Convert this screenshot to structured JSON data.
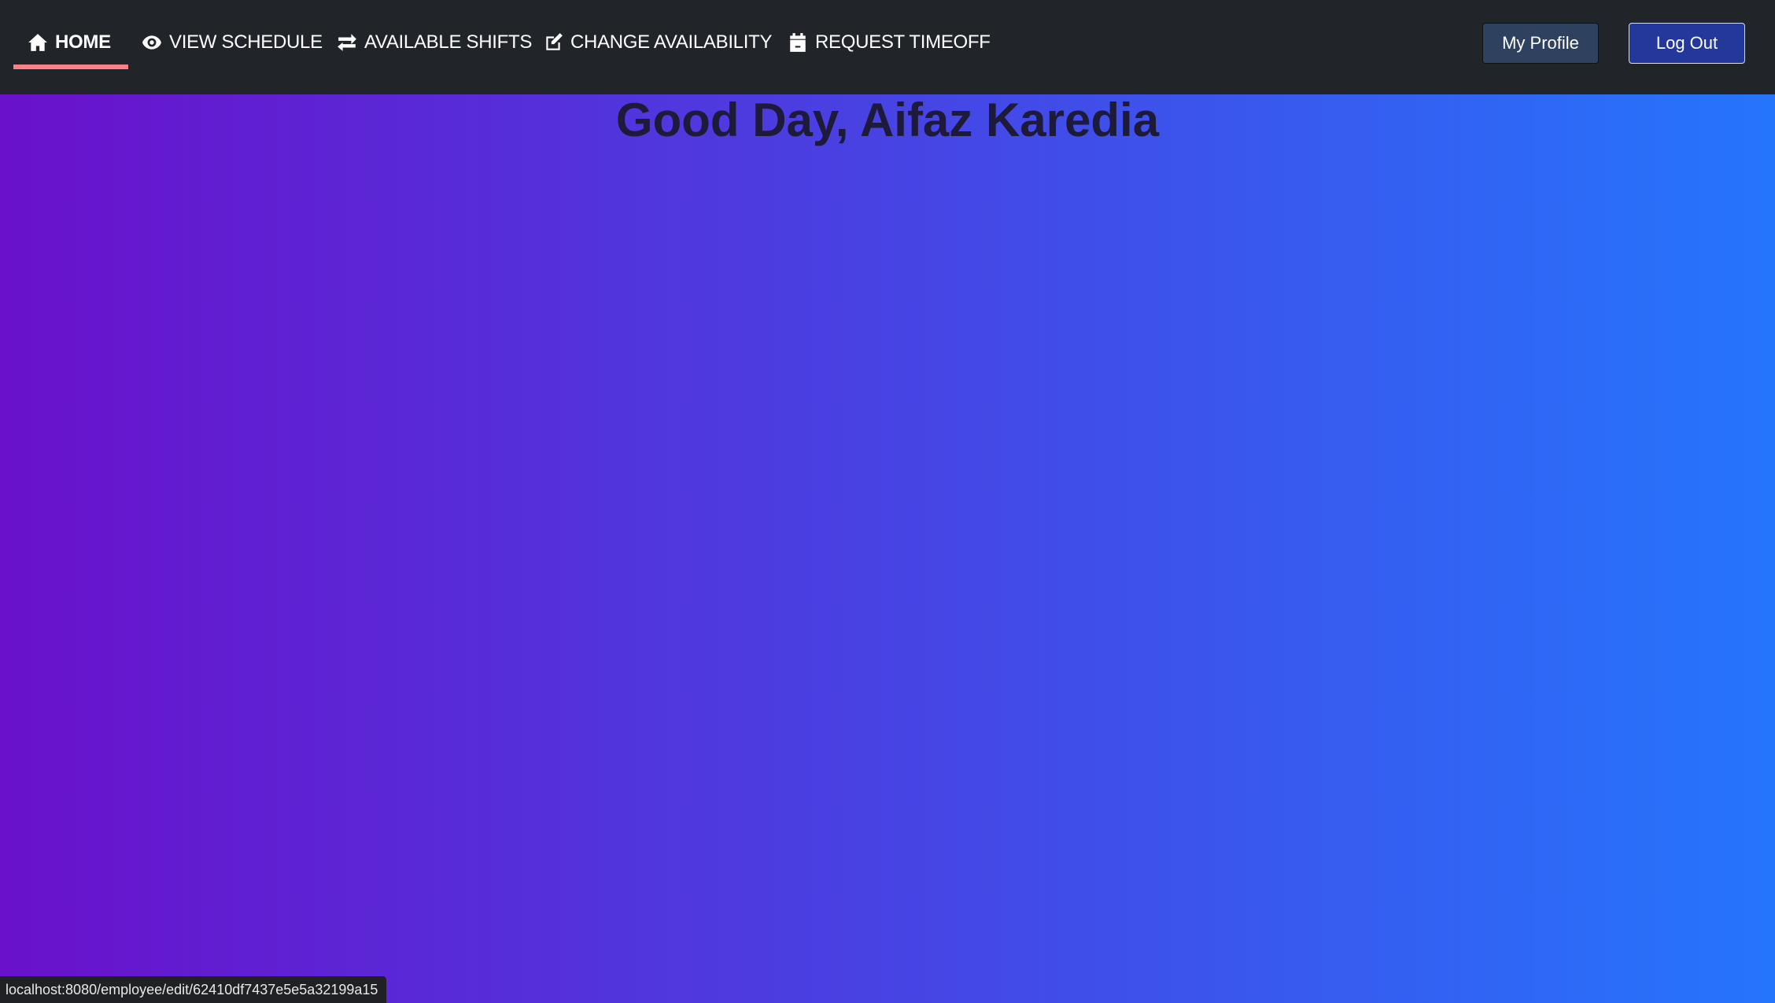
{
  "nav": {
    "items": [
      {
        "label": "HOME",
        "icon": "home-icon",
        "active": true
      },
      {
        "label": "VIEW SCHEDULE",
        "icon": "eye-icon"
      },
      {
        "label": "AVAILABLE SHIFTS",
        "icon": "exchange-icon"
      },
      {
        "label": "CHANGE AVAILABILITY",
        "icon": "edit-icon"
      },
      {
        "label": "REQUEST TIMEOFF",
        "icon": "calendar-icon"
      }
    ],
    "profile_label": "My Profile",
    "logout_label": "Log Out",
    "active_color": "#ff7f86"
  },
  "main": {
    "greeting": "Good Day, Aifaz Karedia"
  },
  "status_bar": {
    "url": "localhost:8080/employee/edit/62410df7437e5e5a32199a15"
  }
}
